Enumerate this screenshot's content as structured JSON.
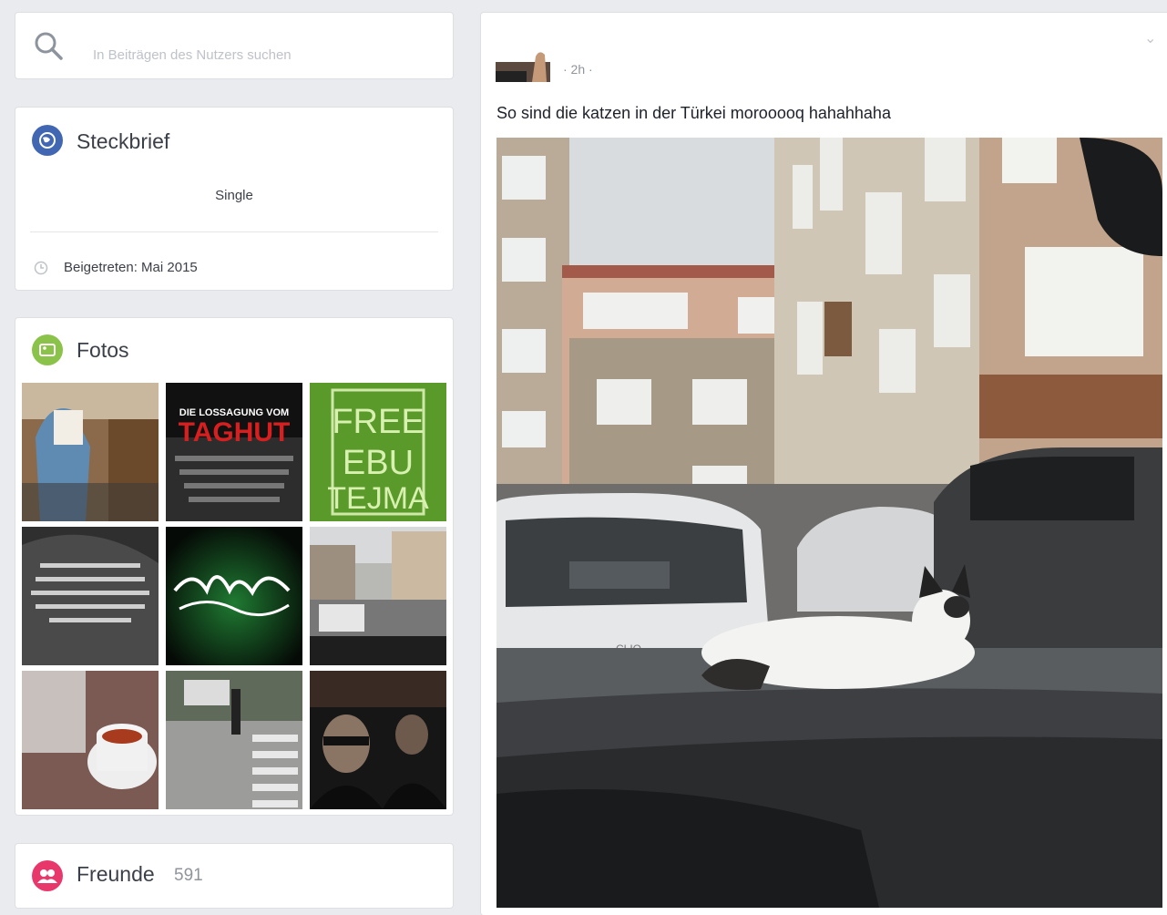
{
  "search": {
    "placeholder": "In Beiträgen des Nutzers suchen"
  },
  "intro": {
    "title": "Steckbrief",
    "relationship": "Single",
    "joined": "Beigetreten: Mai 2015"
  },
  "photos": {
    "title": "Fotos",
    "items": [
      {
        "caption": ""
      },
      {
        "caption": "DIE LOSSAGUNG VOM TAGHUT"
      },
      {
        "caption": "FREE EBU TEJMA"
      },
      {
        "caption": ""
      },
      {
        "caption": ""
      },
      {
        "caption": ""
      },
      {
        "caption": ""
      },
      {
        "caption": ""
      },
      {
        "caption": ""
      }
    ]
  },
  "friends": {
    "title": "Freunde",
    "count": "591"
  },
  "post": {
    "meta": "· 2h ·",
    "text": "So sind die katzen in der Türkei morooooq hahahhaha",
    "chevron": "⌄",
    "photo_car_badge": "CLIO"
  },
  "colors": {
    "intro_icon": "#4267b2",
    "photos_icon": "#8bc34a",
    "friends_icon": "#e8386b",
    "background": "#e9ebee"
  },
  "icons": [
    "search-icon",
    "globe-icon",
    "clock-icon",
    "photos-icon",
    "friends-icon",
    "chevron-down-icon"
  ]
}
